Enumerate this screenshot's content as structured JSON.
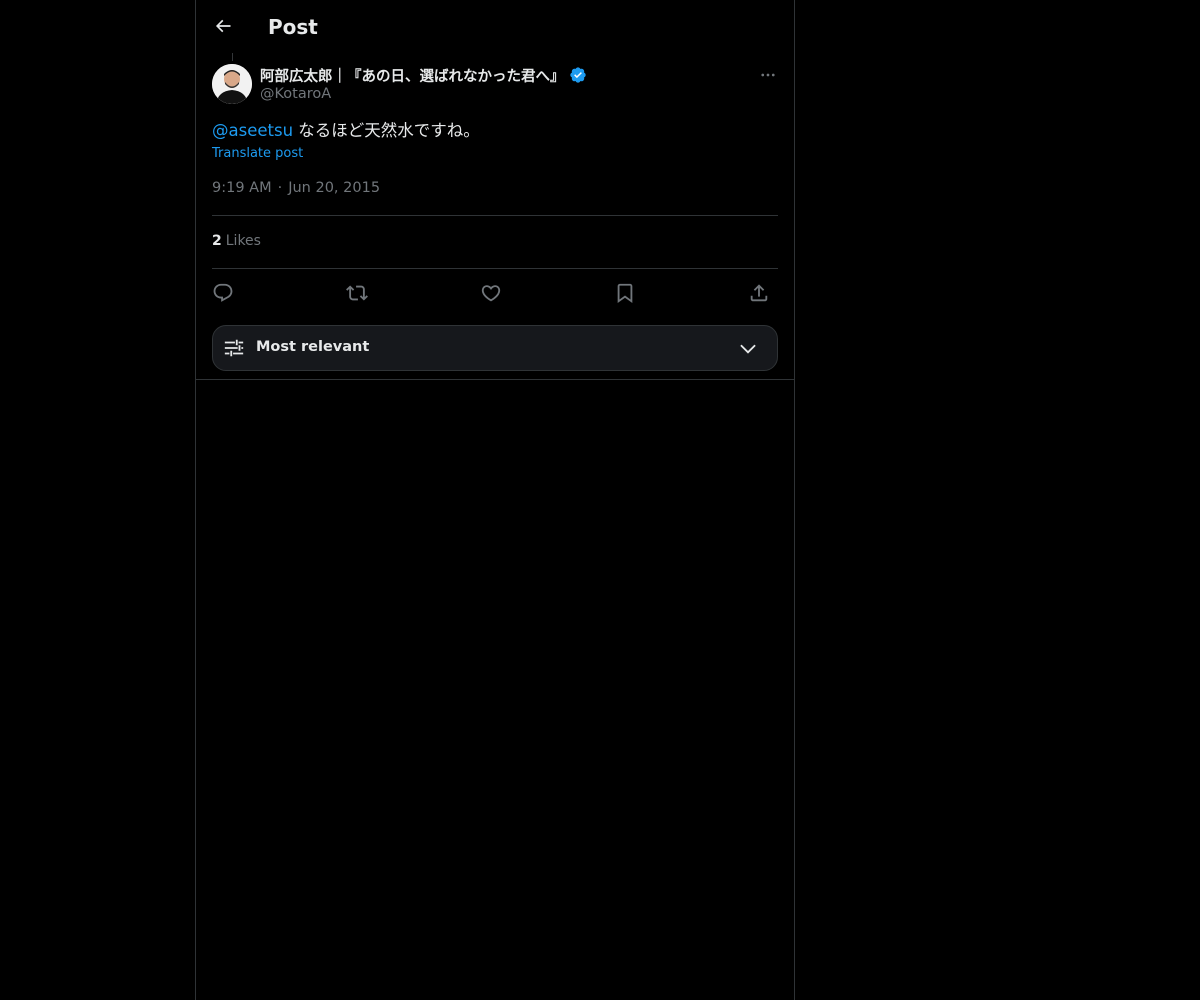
{
  "header": {
    "title": "Post"
  },
  "tweet": {
    "author_name": "阿部広太郎｜『あの日、選ばれなかった君へ』",
    "author_handle": "@KotaroA",
    "mention": "@aseetsu",
    "text": " なるほど天然水ですね。",
    "translate_label": "Translate post",
    "time": "9:19 AM",
    "separator": "·",
    "date": "Jun 20, 2015",
    "likes_count": "2",
    "likes_label": "Likes"
  },
  "sort": {
    "label": "Most relevant"
  },
  "colors": {
    "accent": "#1d9bf0",
    "background": "#000000",
    "muted_text": "#71767b",
    "border": "#2f3336"
  },
  "icons": {
    "back": "arrow-left-icon",
    "verified": "verified-badge-icon",
    "more": "more-horizontal-icon",
    "reply": "reply-icon",
    "repost": "repost-icon",
    "like": "heart-icon",
    "bookmark": "bookmark-icon",
    "share": "share-icon",
    "sort": "sliders-icon",
    "chevron": "chevron-down-icon"
  }
}
